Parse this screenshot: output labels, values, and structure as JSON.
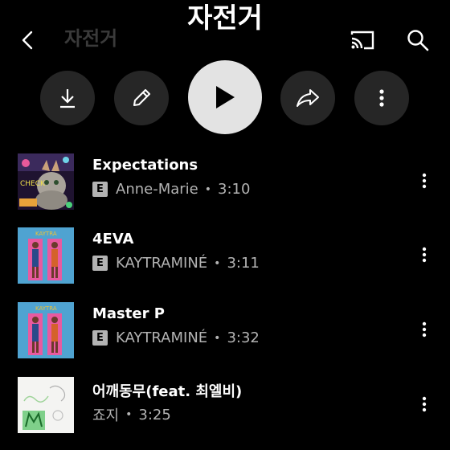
{
  "playlist": {
    "title": "자전거",
    "header_title": "자전거"
  },
  "icons": {
    "back": "back-arrow-icon",
    "cast": "cast-icon",
    "search": "search-icon",
    "download": "download-icon",
    "edit": "pencil-icon",
    "play": "play-icon",
    "share": "share-icon",
    "more": "more-vertical-icon"
  },
  "colors": {
    "background": "#000000",
    "secondary_text": "#b3b3b3",
    "play_button": "#e3e3e3",
    "action_button": "#262626"
  },
  "tracks": [
    {
      "title": "Expectations",
      "explicit": "E",
      "artist": "Anne-Marie",
      "sep": "•",
      "duration": "3:10"
    },
    {
      "title": "4EVA",
      "explicit": "E",
      "artist": "KAYTRAMINÉ",
      "sep": "•",
      "duration": "3:11"
    },
    {
      "title": "Master P",
      "explicit": "E",
      "artist": "KAYTRAMINÉ",
      "sep": "•",
      "duration": "3:32"
    },
    {
      "title": "어깨동무(feat. 최엘비)",
      "explicit": "",
      "artist": "죠지",
      "sep": "•",
      "duration": "3:25"
    }
  ]
}
